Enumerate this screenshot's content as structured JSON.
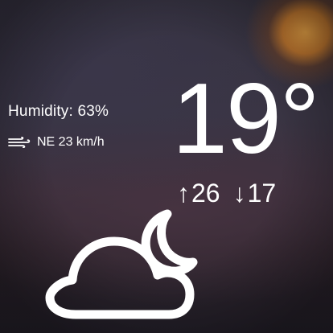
{
  "weather": {
    "humidity_text": "Humidity: 63%",
    "wind": {
      "icon": "wind-icon",
      "text": "NE 23 km/h"
    },
    "temperature": "19°",
    "high": {
      "arrow": "↑",
      "value": "26"
    },
    "low": {
      "arrow": "↓",
      "value": "17"
    },
    "condition_icon": "cloud-moon-icon"
  },
  "colors": {
    "text": "#ffffff",
    "sun_glow": "#f0a846"
  }
}
